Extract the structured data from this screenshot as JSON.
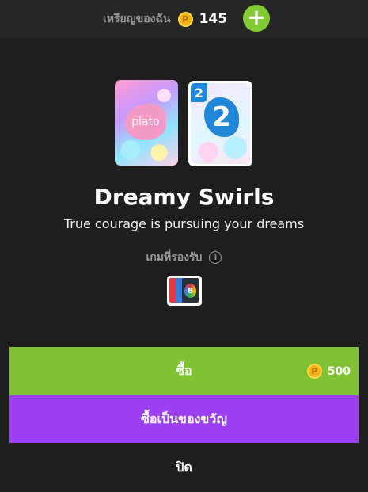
{
  "header": {
    "coins_label": "เหรียญของฉัน",
    "coin_symbol": "P",
    "coins_count": "145",
    "add_symbol": "+"
  },
  "cards": {
    "back_logo": "plato",
    "face_value": "2"
  },
  "theme": {
    "title": "Dreamy Swirls",
    "tagline": "True courage is pursuing your dreams"
  },
  "supported": {
    "label": "เกมที่รองรับ",
    "info_symbol": "i",
    "game_icon_text": "8"
  },
  "actions": {
    "buy_label": "ซื้อ",
    "price": "500",
    "gift_label": "ซื้อเป็นของขวัญ",
    "close_label": "ปิด"
  },
  "colors": {
    "background": "#1e1e1e",
    "buy_green": "#7fc231",
    "gift_purple": "#9b3ff0",
    "coin_gold": "#f5b316",
    "add_green": "#7fcb31"
  }
}
